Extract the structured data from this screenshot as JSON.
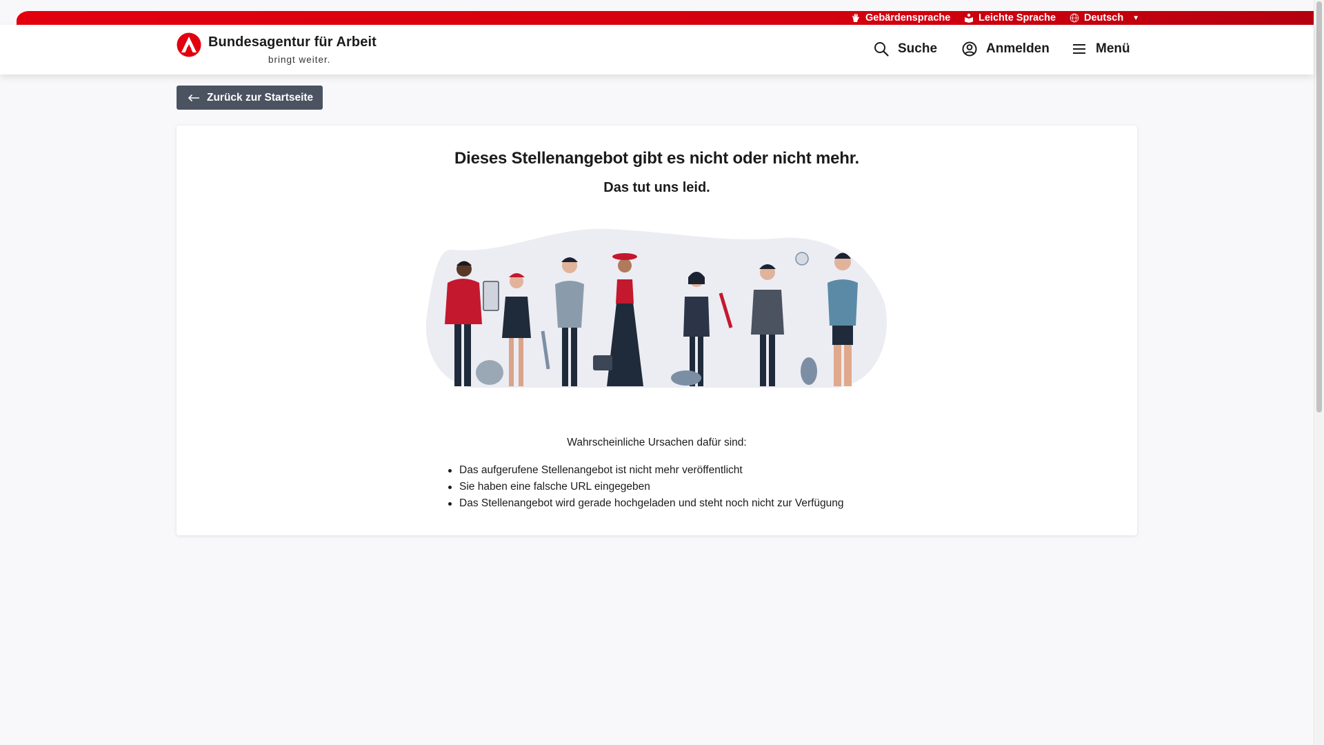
{
  "utility_bar": {
    "sign_language": "Gebärdensprache",
    "easy_language": "Leichte Sprache",
    "language": "Deutsch"
  },
  "header": {
    "logo_name": "Bundesagentur für Arbeit",
    "logo_tagline": "bringt weiter.",
    "search_label": "Suche",
    "login_label": "Anmelden",
    "menu_label": "Menü"
  },
  "back_button": {
    "label": "Zurück zur Startseite"
  },
  "card": {
    "title": "Dieses Stellenangebot gibt es nicht oder nicht mehr.",
    "subtitle": "Das tut uns leid.",
    "reasons_intro": "Wahrscheinliche Ursachen dafür sind:",
    "reasons": [
      "Das aufgerufene Stellenangebot ist nicht mehr veröffentlicht",
      "Sie haben eine falsche URL eingegeben",
      "Das Stellenangebot wird gerade hochgeladen und steht noch nicht zur Verfügung"
    ]
  },
  "colors": {
    "brand_red": "#e2000f",
    "button_dark": "#4b5260",
    "page_background": "#f8f8fa"
  },
  "icons": [
    "hand-icon",
    "easy-language-icon",
    "globe-icon",
    "caret-down-icon",
    "search-icon",
    "user-icon",
    "menu-icon",
    "arrow-left-icon",
    "ba-logo-icon"
  ]
}
